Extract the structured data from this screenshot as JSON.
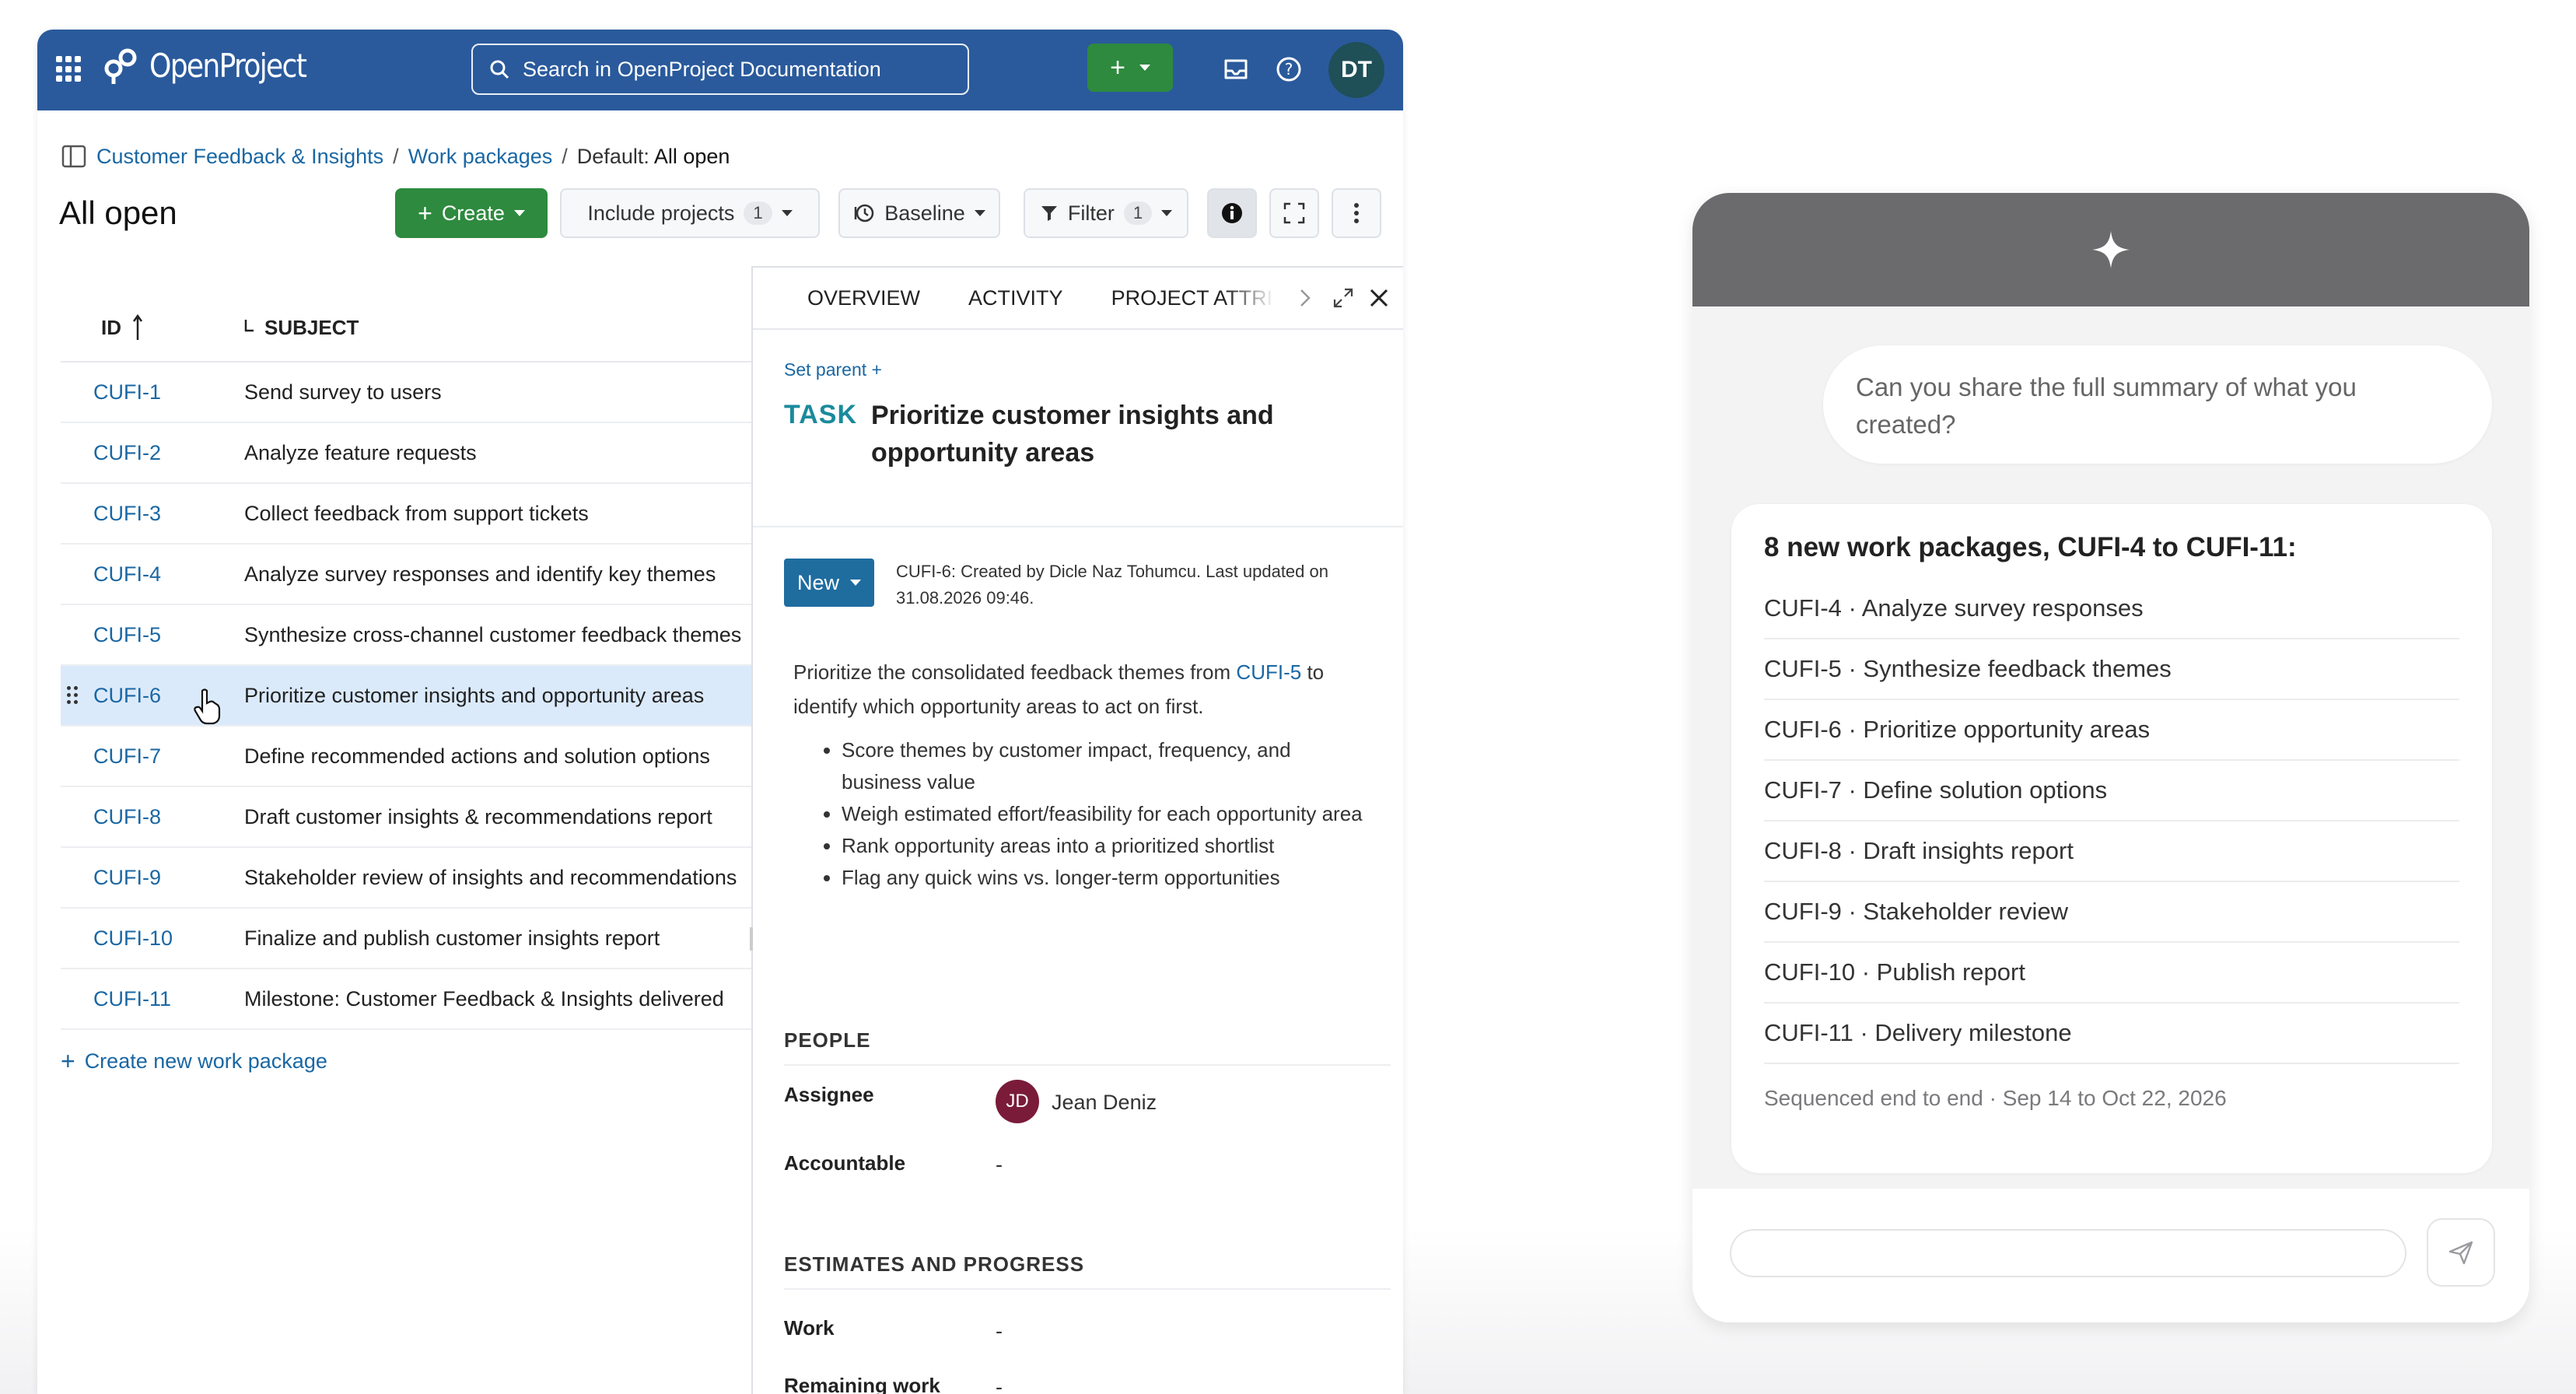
{
  "header": {
    "app_name": "OpenProject",
    "search_label": "Search in OpenProject Documentation",
    "avatar_initials": "DT",
    "brand_color": "#2a5a9c"
  },
  "breadcrumb": {
    "project": "Customer Feedback & Insights",
    "section": "Work packages",
    "view_prefix": "Default:",
    "view_name": "All open",
    "separator": "/"
  },
  "page_title": "All open",
  "toolbar": {
    "create_label": "Create",
    "include_projects_label": "Include projects",
    "include_projects_count": "1",
    "baseline_label": "Baseline",
    "filter_label": "Filter",
    "filter_count": "1"
  },
  "table": {
    "headers": {
      "id": "ID",
      "subject": "SUBJECT"
    },
    "rows": [
      {
        "id": "CUFI-1",
        "subject": "Send survey to users"
      },
      {
        "id": "CUFI-2",
        "subject": "Analyze feature requests"
      },
      {
        "id": "CUFI-3",
        "subject": "Collect feedback from support tickets"
      },
      {
        "id": "CUFI-4",
        "subject": "Analyze survey responses and identify key themes"
      },
      {
        "id": "CUFI-5",
        "subject": "Synthesize cross-channel customer feedback themes"
      },
      {
        "id": "CUFI-6",
        "subject": "Prioritize customer insights and opportunity areas"
      },
      {
        "id": "CUFI-7",
        "subject": "Define recommended actions and solution options"
      },
      {
        "id": "CUFI-8",
        "subject": "Draft customer insights & recommendations report"
      },
      {
        "id": "CUFI-9",
        "subject": "Stakeholder review of insights and recommendations"
      },
      {
        "id": "CUFI-10",
        "subject": "Finalize and publish customer insights report"
      },
      {
        "id": "CUFI-11",
        "subject": "Milestone: Customer Feedback & Insights delivered"
      }
    ],
    "create_new_label": "Create new work package"
  },
  "detail": {
    "tabs": [
      "OVERVIEW",
      "ACTIVITY",
      "PROJECT ATTRIBUTES"
    ],
    "set_parent_label": "Set parent",
    "type": "TASK",
    "subject": "Prioritize customer insights and opportunity areas",
    "status": "New",
    "created_info": "CUFI-6: Created by Dicle Naz Tohumcu. Last updated on 31.08.2026 09:46.",
    "description_pre": "Prioritize the consolidated feedback themes from",
    "description_link": "CUFI-5",
    "description_post": "to identify which opportunity areas to act on first.",
    "bullets": [
      "Score themes by customer impact, frequency, and business value",
      "Weigh estimated effort/feasibility for each opportunity area",
      "Rank opportunity areas into a prioritized shortlist",
      "Flag any quick wins vs. longer-term opportunities"
    ],
    "people_title": "PEOPLE",
    "assignee_label": "Assignee",
    "assignee_initials": "JD",
    "assignee_name": "Jean Deniz",
    "accountable_label": "Accountable",
    "accountable_value": "-",
    "estimates_title": "ESTIMATES AND PROGRESS",
    "work_label": "Work",
    "work_value": "-",
    "remaining_label": "Remaining work",
    "remaining_value": "-"
  },
  "chat": {
    "user_message": "Can you share the full summary of what you created?",
    "bot_title": "8 new work packages, CUFI-4 to CUFI-11:",
    "items": [
      "CUFI-4 · Analyze survey responses",
      "CUFI-5 · Synthesize feedback themes",
      "CUFI-6 · Prioritize opportunity areas",
      "CUFI-7 · Define solution options",
      "CUFI-8 · Draft insights report",
      "CUFI-9 · Stakeholder review",
      "CUFI-10 · Publish report",
      "CUFI-11 · Delivery milestone"
    ],
    "footer": "Sequenced end to end · Sep 14 to Oct 22, 2026",
    "input_placeholder": ""
  }
}
